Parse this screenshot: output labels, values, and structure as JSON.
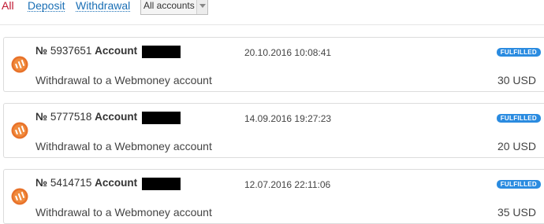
{
  "filters": {
    "all": "All",
    "deposit": "Deposit",
    "withdrawal": "Withdrawal",
    "account_select": "All accounts"
  },
  "colors": {
    "active_filter": "#c0152f",
    "link": "#1a6fb5",
    "status_badge": "#2a8be0",
    "logo": "#e8722a"
  },
  "icons": {
    "logo": "webmoney-logo-icon",
    "dropdown": "chevron-down-icon"
  },
  "transactions": [
    {
      "number_prefix": "№",
      "number": "5937651",
      "account_label": "Account",
      "datetime": "20.10.2016 10:08:41",
      "status": "FULFILLED",
      "description": "Withdrawal to a Webmoney account",
      "amount": "30 USD"
    },
    {
      "number_prefix": "№",
      "number": "5777518",
      "account_label": "Account",
      "datetime": "14.09.2016 19:27:23",
      "status": "FULFILLED",
      "description": "Withdrawal to a Webmoney account",
      "amount": "20 USD"
    },
    {
      "number_prefix": "№",
      "number": "5414715",
      "account_label": "Account",
      "datetime": "12.07.2016 22:11:06",
      "status": "FULFILLED",
      "description": "Withdrawal to a Webmoney account",
      "amount": "35 USD"
    }
  ]
}
